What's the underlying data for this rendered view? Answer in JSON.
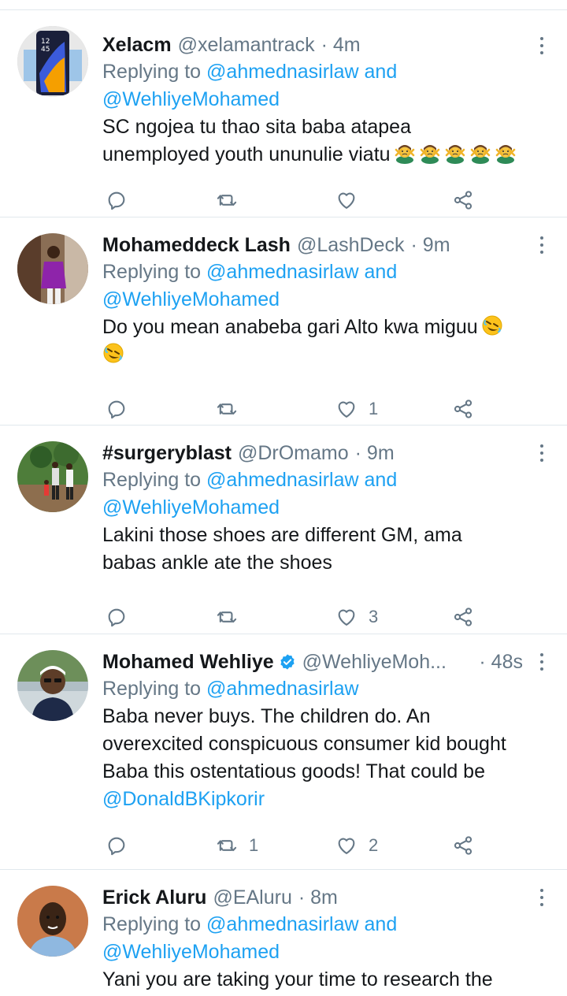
{
  "tweets": [
    {
      "name": "Xelacm",
      "handle": "@xelamantrack",
      "time": "· 4m",
      "replying_prefix": "Replying to",
      "replying_1": "@ahmednasirlaw",
      "replying_and": "and",
      "replying_2": "@WehliyeMohamed",
      "text_line1": "SC ngojea tu thao sita baba atapea",
      "text_line2": "unemployed youth ununulie viatu",
      "emoji": "person-gesturing-no",
      "emoji_count": 5,
      "likes": "",
      "retweets": ""
    },
    {
      "name": "Mohameddeck Lash",
      "handle": "@LashDeck",
      "time": "· 9m",
      "replying_prefix": "Replying to",
      "replying_1": "@ahmednasirlaw",
      "replying_and": "and",
      "replying_2": "@WehliyeMohamed",
      "text_line1": "Do you mean anabeba gari Alto kwa miguu",
      "emoji": "rolling-on-floor-laughing",
      "likes": "1",
      "retweets": ""
    },
    {
      "name": "#surgeryblast",
      "handle": "@DrOmamo",
      "time": "· 9m",
      "replying_prefix": "Replying to",
      "replying_1": "@ahmednasirlaw",
      "replying_and": "and",
      "replying_2": "@WehliyeMohamed",
      "text_line1": "Lakini those shoes are different GM, ama",
      "text_line2": "babas ankle ate the shoes",
      "likes": "3",
      "retweets": ""
    },
    {
      "name": "Mohamed Wehliye",
      "handle": "@WehliyeMoh...",
      "time": "· 48s",
      "verified": true,
      "replying_prefix": "Replying to",
      "replying_1": "@ahmednasirlaw",
      "text_line1": "Baba never buys. The children do. An",
      "text_line2": "overexcited conspicuous consumer kid bought",
      "text_line3": "Baba this ostentatious goods! That could be",
      "text_mention": "@DonaldBKipkorir",
      "likes": "2",
      "retweets": "1"
    },
    {
      "name": "Erick Aluru",
      "handle": "@EAluru",
      "time": "· 8m",
      "replying_prefix": "Replying to",
      "replying_1": "@ahmednasirlaw",
      "replying_and": "and",
      "replying_2": "@WehliyeMohamed",
      "text_line1": "Yani you are taking your time to research the"
    }
  ],
  "colors": {
    "link": "#1da1f2",
    "secondary": "#657786",
    "divider": "#e1e8ed"
  }
}
